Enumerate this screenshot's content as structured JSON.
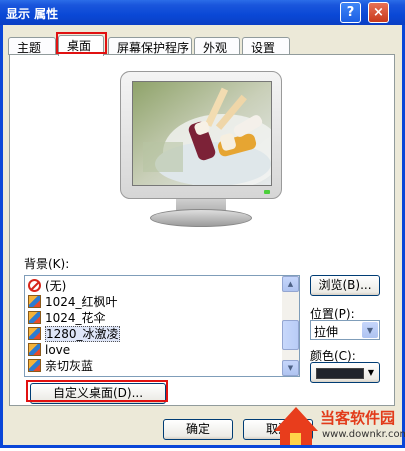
{
  "window": {
    "title": "显示 属性",
    "help_glyph": "?",
    "close_glyph": "×"
  },
  "tabs": [
    {
      "label": "主题",
      "active": false
    },
    {
      "label": "桌面",
      "active": true
    },
    {
      "label": "屏幕保护程序",
      "active": false
    },
    {
      "label": "外观",
      "active": false
    },
    {
      "label": "设置",
      "active": false
    }
  ],
  "background": {
    "label": "背景(K):",
    "items": [
      {
        "label": "(无)",
        "icon": "none-icon"
      },
      {
        "label": "1024_红枫叶",
        "icon": "image-file-icon"
      },
      {
        "label": "1024_花伞",
        "icon": "image-file-icon"
      },
      {
        "label": "1280_冰激凌",
        "icon": "image-file-icon",
        "selected": true
      },
      {
        "label": "love",
        "icon": "image-file-icon"
      },
      {
        "label": "亲切灰蓝",
        "icon": "image-file-icon"
      }
    ]
  },
  "browse_button": "浏览(B)...",
  "position": {
    "label": "位置(P):",
    "value": "拉伸"
  },
  "color": {
    "label": "颜色(C):",
    "value": "#20242c"
  },
  "customize_button": "自定义桌面(D)...",
  "footer": {
    "ok": "确定",
    "cancel": "取消"
  },
  "watermark": {
    "name": "当客软件园",
    "url": "www.downkr.com"
  },
  "colors": {
    "titlebar": "#0a48d6",
    "highlight": "#e11111"
  }
}
